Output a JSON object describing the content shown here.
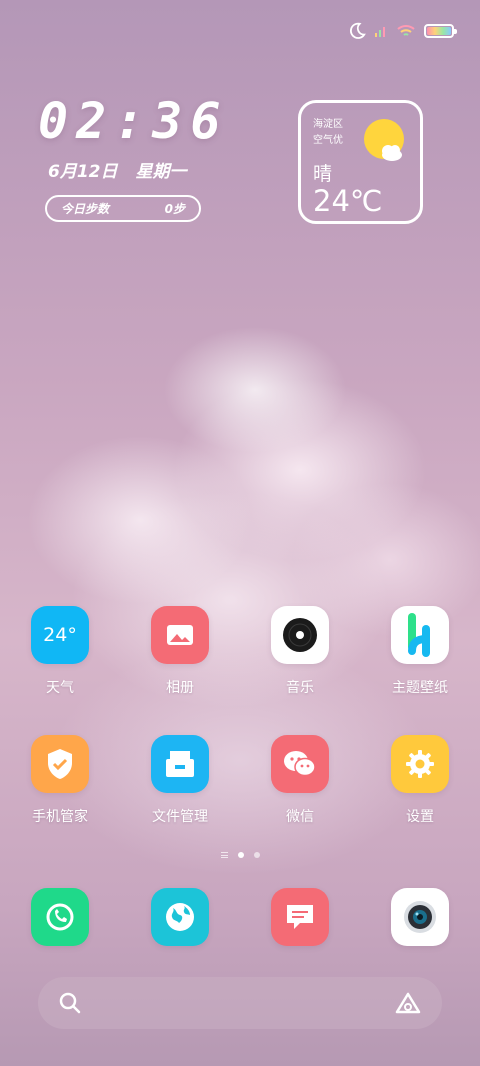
{
  "status_bar": {
    "icons": [
      "moon-icon",
      "signal-icon",
      "wifi-icon",
      "battery-icon"
    ]
  },
  "clock": {
    "time": "02:36",
    "date": "6月12日",
    "weekday": "星期一",
    "steps_label": "今日步数",
    "steps_value": "0步"
  },
  "weather_widget": {
    "district": "海淀区",
    "air_quality": "空气优",
    "condition": "晴",
    "temperature": "24℃"
  },
  "apps_row1": [
    {
      "label": "天气",
      "icon": "weather-icon",
      "icon_text": "24°",
      "color": "#10b7f5"
    },
    {
      "label": "相册",
      "icon": "gallery-icon",
      "color": "#f46b75"
    },
    {
      "label": "音乐",
      "icon": "music-icon",
      "color": "#ffffff"
    },
    {
      "label": "主题壁纸",
      "icon": "themes-icon",
      "color": "#ffffff"
    }
  ],
  "apps_row2": [
    {
      "label": "手机管家",
      "icon": "security-icon",
      "color": "#ffa64a"
    },
    {
      "label": "文件管理",
      "icon": "file-manager-icon",
      "color": "#1db5f3"
    },
    {
      "label": "微信",
      "icon": "wechat-icon",
      "color": "#f46b75"
    },
    {
      "label": "设置",
      "icon": "settings-icon",
      "color": "#ffc93c"
    }
  ],
  "dock": [
    {
      "icon": "phone-icon",
      "color": "#1fd98a"
    },
    {
      "icon": "browser-icon",
      "color": "#1cc4d8"
    },
    {
      "icon": "messages-icon",
      "color": "#f46b75"
    },
    {
      "icon": "camera-icon",
      "color": "#ffffff"
    }
  ],
  "page_indicator": {
    "pages": 2,
    "current": 1
  }
}
